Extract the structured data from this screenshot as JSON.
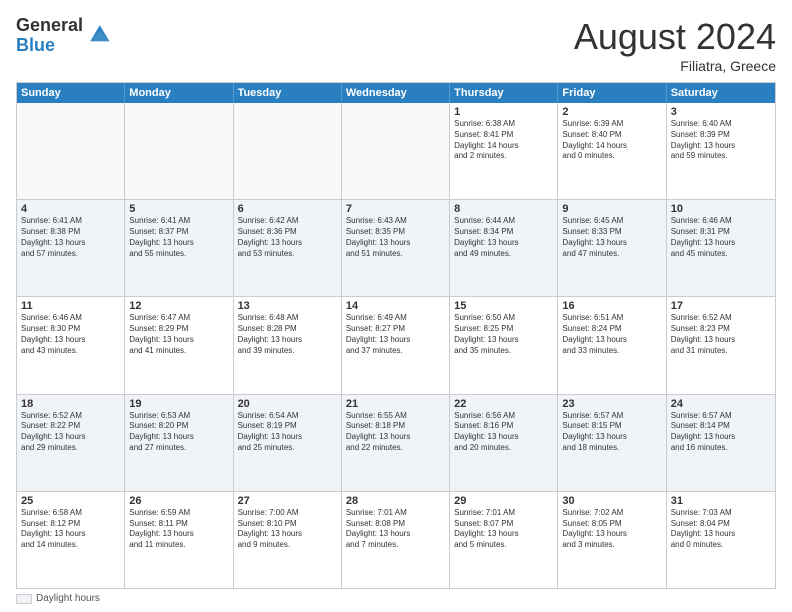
{
  "logo": {
    "general": "General",
    "blue": "Blue"
  },
  "title": "August 2024",
  "location": "Filiatra, Greece",
  "dayHeaders": [
    "Sunday",
    "Monday",
    "Tuesday",
    "Wednesday",
    "Thursday",
    "Friday",
    "Saturday"
  ],
  "footer": {
    "label": "Daylight hours"
  },
  "weeks": [
    [
      {
        "date": "",
        "info": ""
      },
      {
        "date": "",
        "info": ""
      },
      {
        "date": "",
        "info": ""
      },
      {
        "date": "",
        "info": ""
      },
      {
        "date": "1",
        "info": "Sunrise: 6:38 AM\nSunset: 8:41 PM\nDaylight: 14 hours\nand 2 minutes."
      },
      {
        "date": "2",
        "info": "Sunrise: 6:39 AM\nSunset: 8:40 PM\nDaylight: 14 hours\nand 0 minutes."
      },
      {
        "date": "3",
        "info": "Sunrise: 6:40 AM\nSunset: 8:39 PM\nDaylight: 13 hours\nand 59 minutes."
      }
    ],
    [
      {
        "date": "4",
        "info": "Sunrise: 6:41 AM\nSunset: 8:38 PM\nDaylight: 13 hours\nand 57 minutes."
      },
      {
        "date": "5",
        "info": "Sunrise: 6:41 AM\nSunset: 8:37 PM\nDaylight: 13 hours\nand 55 minutes."
      },
      {
        "date": "6",
        "info": "Sunrise: 6:42 AM\nSunset: 8:36 PM\nDaylight: 13 hours\nand 53 minutes."
      },
      {
        "date": "7",
        "info": "Sunrise: 6:43 AM\nSunset: 8:35 PM\nDaylight: 13 hours\nand 51 minutes."
      },
      {
        "date": "8",
        "info": "Sunrise: 6:44 AM\nSunset: 8:34 PM\nDaylight: 13 hours\nand 49 minutes."
      },
      {
        "date": "9",
        "info": "Sunrise: 6:45 AM\nSunset: 8:33 PM\nDaylight: 13 hours\nand 47 minutes."
      },
      {
        "date": "10",
        "info": "Sunrise: 6:46 AM\nSunset: 8:31 PM\nDaylight: 13 hours\nand 45 minutes."
      }
    ],
    [
      {
        "date": "11",
        "info": "Sunrise: 6:46 AM\nSunset: 8:30 PM\nDaylight: 13 hours\nand 43 minutes."
      },
      {
        "date": "12",
        "info": "Sunrise: 6:47 AM\nSunset: 8:29 PM\nDaylight: 13 hours\nand 41 minutes."
      },
      {
        "date": "13",
        "info": "Sunrise: 6:48 AM\nSunset: 8:28 PM\nDaylight: 13 hours\nand 39 minutes."
      },
      {
        "date": "14",
        "info": "Sunrise: 6:49 AM\nSunset: 8:27 PM\nDaylight: 13 hours\nand 37 minutes."
      },
      {
        "date": "15",
        "info": "Sunrise: 6:50 AM\nSunset: 8:25 PM\nDaylight: 13 hours\nand 35 minutes."
      },
      {
        "date": "16",
        "info": "Sunrise: 6:51 AM\nSunset: 8:24 PM\nDaylight: 13 hours\nand 33 minutes."
      },
      {
        "date": "17",
        "info": "Sunrise: 6:52 AM\nSunset: 8:23 PM\nDaylight: 13 hours\nand 31 minutes."
      }
    ],
    [
      {
        "date": "18",
        "info": "Sunrise: 6:52 AM\nSunset: 8:22 PM\nDaylight: 13 hours\nand 29 minutes."
      },
      {
        "date": "19",
        "info": "Sunrise: 6:53 AM\nSunset: 8:20 PM\nDaylight: 13 hours\nand 27 minutes."
      },
      {
        "date": "20",
        "info": "Sunrise: 6:54 AM\nSunset: 8:19 PM\nDaylight: 13 hours\nand 25 minutes."
      },
      {
        "date": "21",
        "info": "Sunrise: 6:55 AM\nSunset: 8:18 PM\nDaylight: 13 hours\nand 22 minutes."
      },
      {
        "date": "22",
        "info": "Sunrise: 6:56 AM\nSunset: 8:16 PM\nDaylight: 13 hours\nand 20 minutes."
      },
      {
        "date": "23",
        "info": "Sunrise: 6:57 AM\nSunset: 8:15 PM\nDaylight: 13 hours\nand 18 minutes."
      },
      {
        "date": "24",
        "info": "Sunrise: 6:57 AM\nSunset: 8:14 PM\nDaylight: 13 hours\nand 16 minutes."
      }
    ],
    [
      {
        "date": "25",
        "info": "Sunrise: 6:58 AM\nSunset: 8:12 PM\nDaylight: 13 hours\nand 14 minutes."
      },
      {
        "date": "26",
        "info": "Sunrise: 6:59 AM\nSunset: 8:11 PM\nDaylight: 13 hours\nand 11 minutes."
      },
      {
        "date": "27",
        "info": "Sunrise: 7:00 AM\nSunset: 8:10 PM\nDaylight: 13 hours\nand 9 minutes."
      },
      {
        "date": "28",
        "info": "Sunrise: 7:01 AM\nSunset: 8:08 PM\nDaylight: 13 hours\nand 7 minutes."
      },
      {
        "date": "29",
        "info": "Sunrise: 7:01 AM\nSunset: 8:07 PM\nDaylight: 13 hours\nand 5 minutes."
      },
      {
        "date": "30",
        "info": "Sunrise: 7:02 AM\nSunset: 8:05 PM\nDaylight: 13 hours\nand 3 minutes."
      },
      {
        "date": "31",
        "info": "Sunrise: 7:03 AM\nSunset: 8:04 PM\nDaylight: 13 hours\nand 0 minutes."
      }
    ]
  ]
}
